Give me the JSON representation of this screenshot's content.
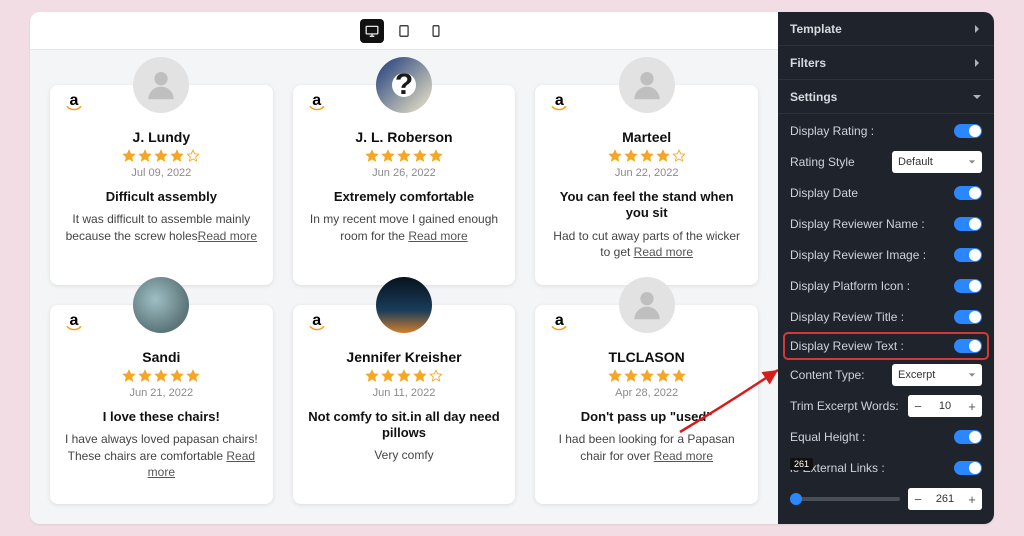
{
  "device_bar": {
    "active": "desktop"
  },
  "reviews": [
    {
      "name": "J. Lundy",
      "date": "Jul 09, 2022",
      "rating": 4,
      "title": "Difficult assembly",
      "text": "It was difficult to assemble mainly because the screw holes",
      "read_more": "Read more",
      "avatar": "placeholder"
    },
    {
      "name": "J. L. Roberson",
      "date": "Jun 26, 2022",
      "rating": 5,
      "title": "Extremely comfortable",
      "text": "In my recent move I gained enough room for the ",
      "read_more": "Read more",
      "avatar": "q"
    },
    {
      "name": "Marteel",
      "date": "Jun 22, 2022",
      "rating": 4,
      "title": "You can feel the stand when you sit",
      "text": "Had to cut away parts of the wicker to get ",
      "read_more": "Read more",
      "avatar": "placeholder"
    },
    {
      "name": "Sandi",
      "date": "Jun 21, 2022",
      "rating": 5,
      "title": "I love these chairs!",
      "text": "I have always loved papasan chairs! These chairs are comfortable ",
      "read_more": "Read more",
      "avatar": "color2"
    },
    {
      "name": "Jennifer Kreisher",
      "date": "Jun 11, 2022",
      "rating": 4,
      "title": "Not comfy to sit.in all day need pillows",
      "text": "Very comfy",
      "read_more": "",
      "avatar": "color3"
    },
    {
      "name": "TLCLASON",
      "date": "Apr 28, 2022",
      "rating": 5,
      "title": "Don't pass up \"used\"",
      "text": "I had been looking for a Papasan chair for over ",
      "read_more": "Read more",
      "avatar": "placeholder"
    }
  ],
  "sidebar": {
    "sections": {
      "template": "Template",
      "filters": "Filters",
      "settings": "Settings"
    },
    "rows": {
      "display_rating": "Display Rating :",
      "rating_style": "Rating Style",
      "rating_style_value": "Default",
      "display_date": "Display Date",
      "display_reviewer_name": "Display Reviewer Name :",
      "display_reviewer_image": "Display Reviewer Image :",
      "display_platform_icon": "Display Platform Icon :",
      "display_review_title": "Display Review Title :",
      "display_review_text": "Display Review Text :",
      "content_type": "Content Type:",
      "content_type_value": "Excerpt",
      "trim_excerpt": "Trim Excerpt Words:",
      "trim_value": "10",
      "equal_height": "Equal Height :",
      "external_links": "le External Links :",
      "slider_value": "261",
      "badge": "261"
    }
  }
}
